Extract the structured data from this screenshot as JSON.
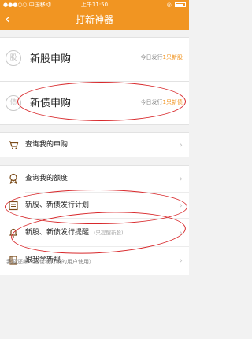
{
  "status": {
    "carrier": "●●●○○ 中国移动",
    "time": "上午11:50",
    "battery": "◎"
  },
  "nav": {
    "back": "‹",
    "title": "打新神器"
  },
  "subscribe": [
    {
      "icon_char": "股",
      "title": "新股申购",
      "today_prefix": "今日发行",
      "today_highlight": "1只新股"
    },
    {
      "icon_char": "债",
      "title": "新债申购",
      "today_prefix": "今日发行",
      "today_highlight": "1只新债"
    }
  ],
  "menu": {
    "query_subscription": "查询我的申购",
    "query_quota": "查询我的额度",
    "issue_plan": "新股、新债发行计划",
    "issue_reminder": "新股、新债发行提醒",
    "issue_reminder_hint": "(只提醒新股)",
    "learn_rules": "跟我学新规"
  },
  "footer": {
    "note": "我要还款（融信钱打新的用户使用）"
  },
  "colors": {
    "accent": "#f19522",
    "annotation": "#d8282b"
  }
}
